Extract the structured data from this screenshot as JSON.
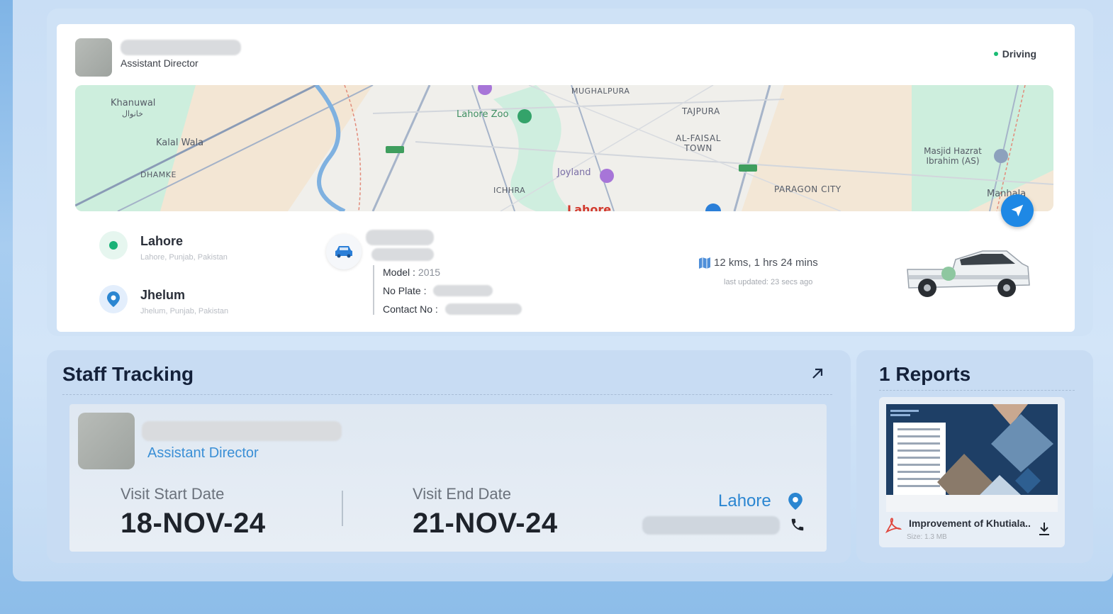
{
  "vehicle_card": {
    "driver_role": "Assistant Director",
    "status": "Driving",
    "status_color": "#1abc74"
  },
  "map": {
    "labels": {
      "khanuwal": "Khanuwal",
      "khanuwal_urdu": "خانوال",
      "kalal_wala": "Kalal Wala",
      "dhamke": "DHAMKE",
      "lahore_zoo": "Lahore Zoo",
      "mughalpura": "MUGHALPURA",
      "tajpura": "TAJPURA",
      "al_faisal_town": "AL-FAISAL TOWN",
      "joyland": "Joyland",
      "ichhra": "ICHHRA",
      "paragon_city": "PARAGON CITY",
      "masjid": "Masjid Hazrat Ibrahim (AS)",
      "manhala": "Manhala",
      "lahore": "Lahore"
    },
    "nav_button_icon": "navigation-arrow-icon"
  },
  "route": {
    "origin": {
      "name": "Lahore",
      "sub": "Lahore, Punjab, Pakistan"
    },
    "destination": {
      "name": "Jhelum",
      "sub": "Jhelum, Punjab, Pakistan"
    }
  },
  "vehicle_details": {
    "model_label": "Model :",
    "model_value": "2015",
    "plate_label": "No Plate :",
    "contact_label": "Contact No :"
  },
  "trip": {
    "summary": "12 kms, 1 hrs 24 mins",
    "last_updated": "last updated: 23 secs ago"
  },
  "staff_tracking": {
    "title": "Staff Tracking",
    "role": "Assistant Director",
    "visit_start_label": "Visit Start Date",
    "visit_start_value": "18-NOV-24",
    "visit_end_label": "Visit End Date",
    "visit_end_value": "21-NOV-24",
    "location": "Lahore"
  },
  "reports": {
    "title": "1 Reports",
    "items": [
      {
        "name": "Improvement of Khutiala..",
        "size": "Size: 1.3 MB"
      }
    ]
  },
  "colors": {
    "accent_blue": "#2b86d1",
    "nav_blue": "#1e88e5",
    "panel_bg": "#c8dcf3"
  }
}
